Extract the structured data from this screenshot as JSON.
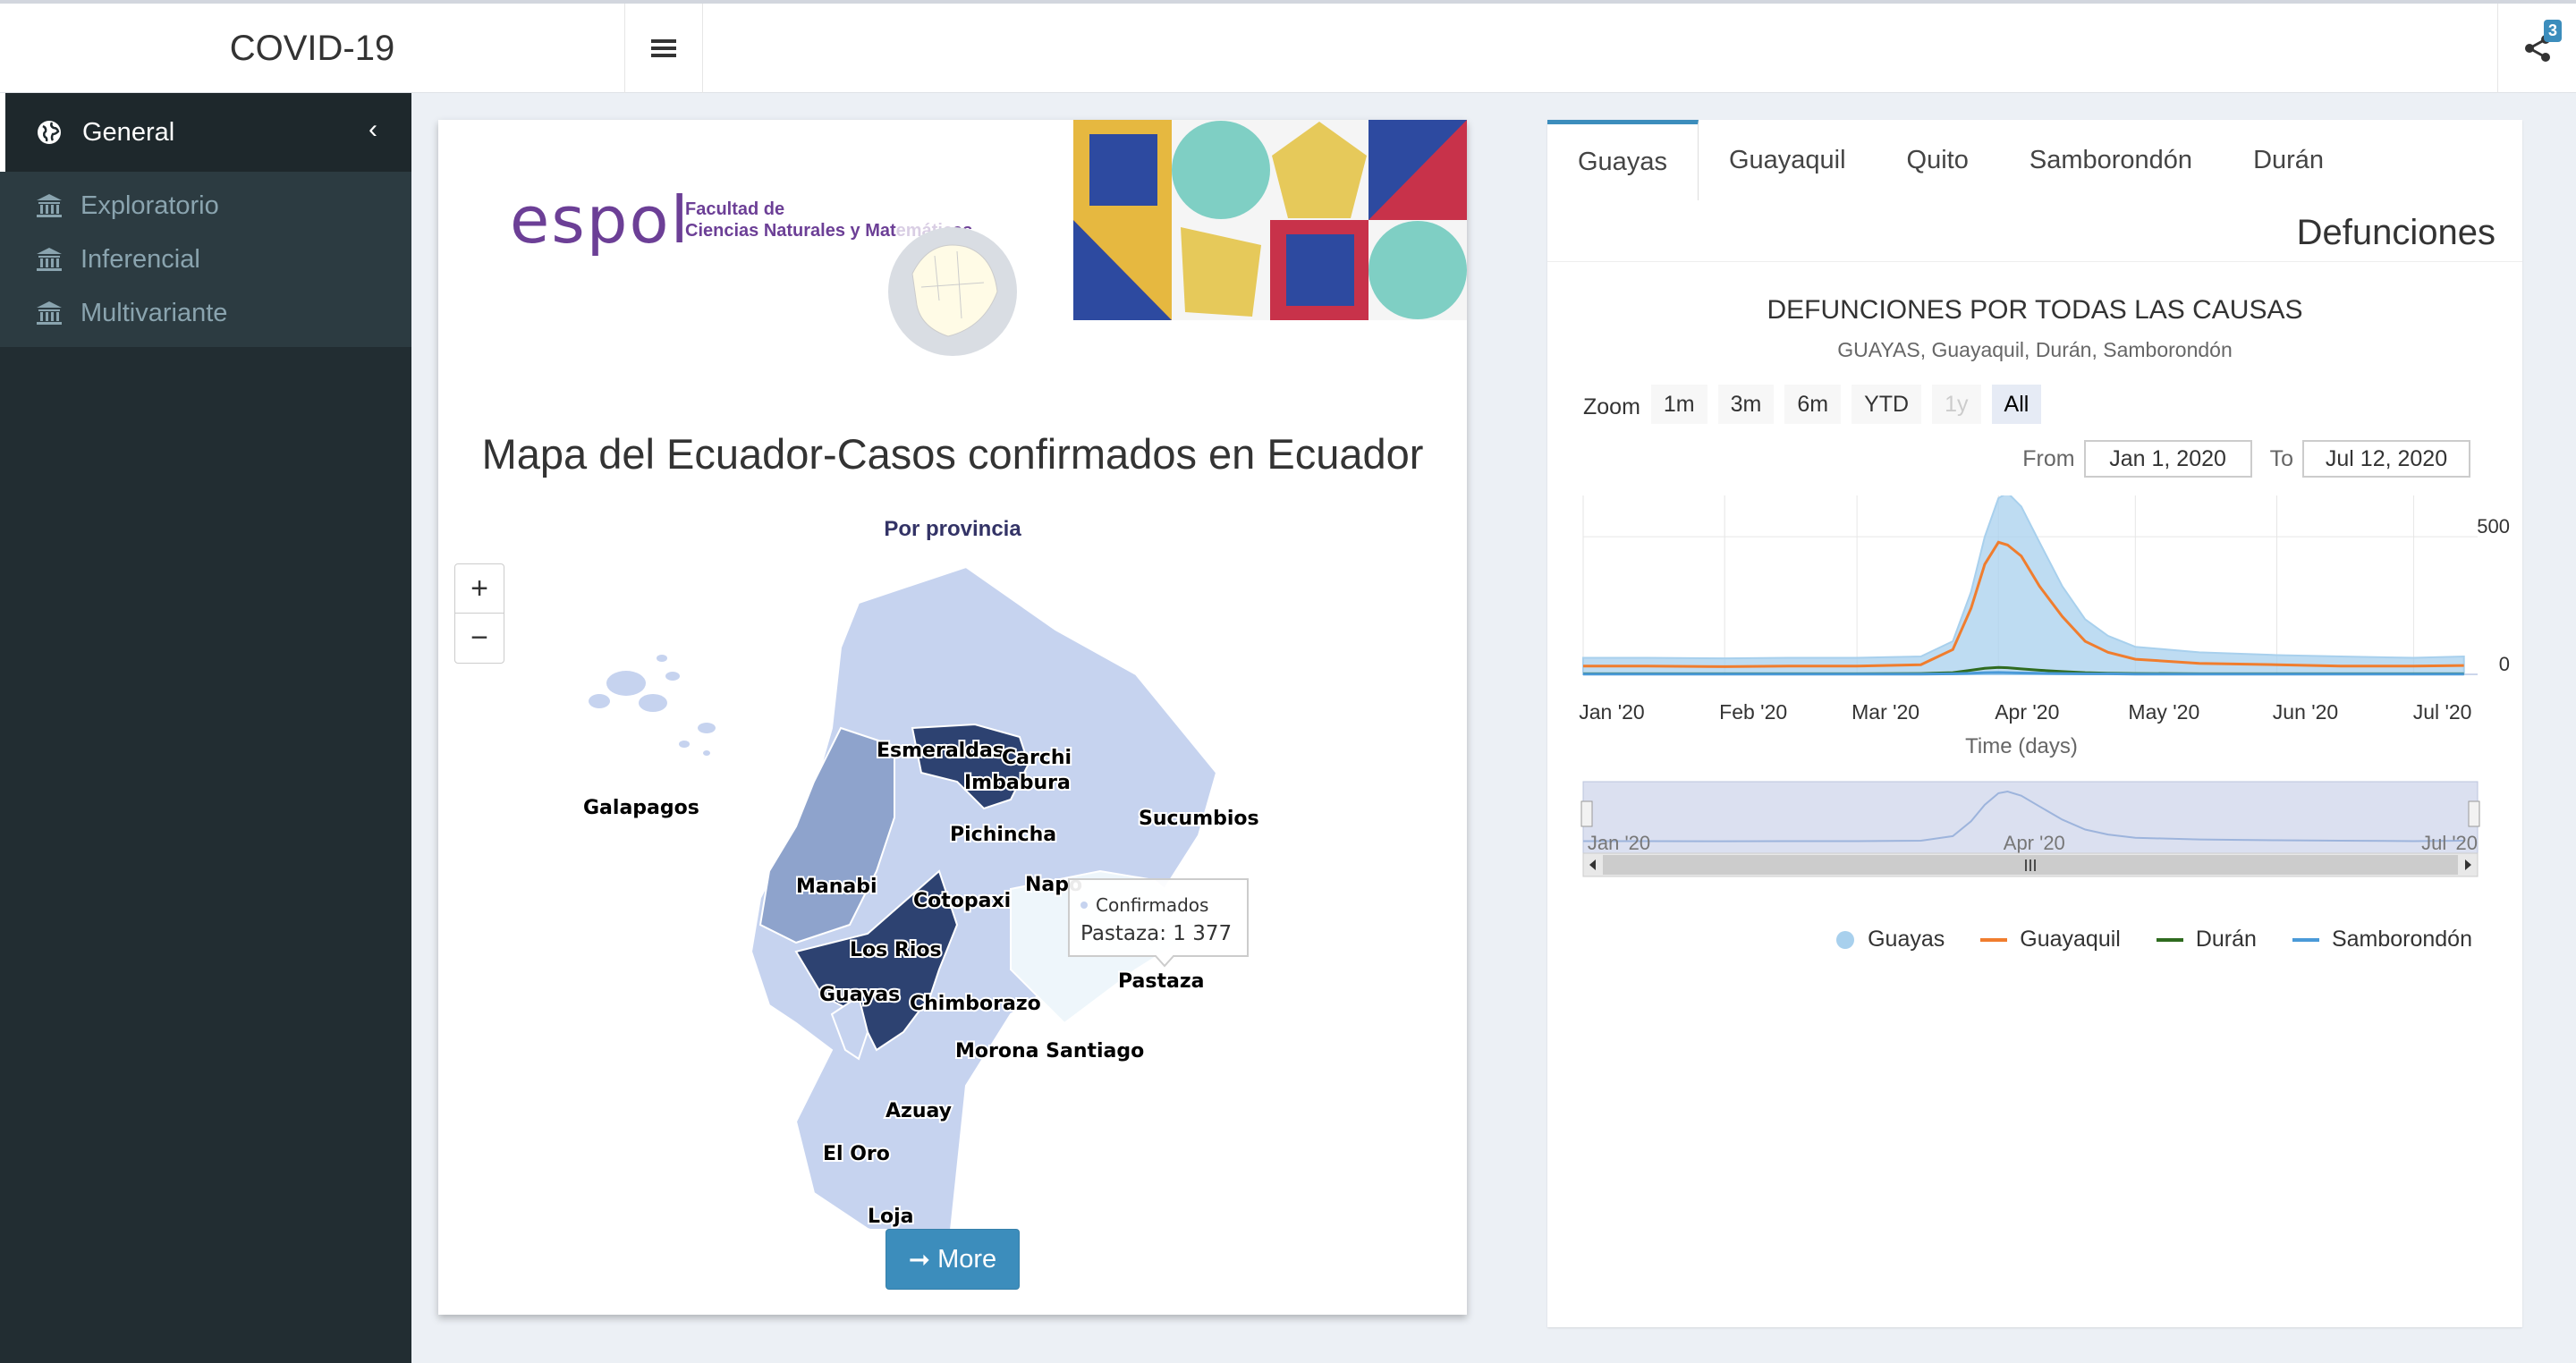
{
  "header": {
    "title": "COVID-19",
    "share_badge": "3"
  },
  "sidebar": {
    "section": "General",
    "items": [
      {
        "label": "Exploratorio"
      },
      {
        "label": "Inferencial"
      },
      {
        "label": "Multivariante"
      }
    ]
  },
  "left": {
    "logo_text": "espol",
    "faculty_line1": "Facultad de",
    "faculty_line2": "Ciencias Naturales y Mat",
    "faculty_line2_end": "as",
    "map_title": "Mapa del Ecuador-Casos confirmados en Ecuador",
    "map_subtitle": "Por provincia",
    "zoom_in": "+",
    "zoom_out": "−",
    "provinces": [
      "Galapagos",
      "Esmeraldas",
      "Carchi",
      "Imbabura",
      "Sucumbios",
      "Pichincha",
      "Manabi",
      "Napo",
      "Cotopaxi",
      "Los Rios",
      "Pastaza",
      "Guayas",
      "Chimborazo",
      "Morona Santiago",
      "Azuay",
      "El Oro",
      "Loja"
    ],
    "tooltip_series": "Confirmados",
    "tooltip_value": "Pastaza: 1 377",
    "more_button": "More",
    "more_icon": "arrow-right-icon"
  },
  "right": {
    "tabs": [
      "Guayas",
      "Guayaquil",
      "Quito",
      "Samborondón",
      "Durán"
    ],
    "active_tab": "Guayas",
    "section_title": "Defunciones",
    "zoom_label": "Zoom",
    "zoom_buttons": [
      "1m",
      "3m",
      "6m",
      "YTD",
      "1y",
      "All"
    ],
    "from_label": "From",
    "from_value": "Jan 1, 2020",
    "to_label": "To",
    "to_value": "Jul 12, 2020",
    "nav_labels": [
      "Jan '20",
      "Apr '20",
      "Jul '20"
    ],
    "nav_mid": "III"
  },
  "chart_data": {
    "type": "area",
    "title": "DEFUNCIONES POR TODAS LAS CAUSAS",
    "subtitle": "GUAYAS, Guayaquil, Durán, Samborondón",
    "xlabel": "Time (days)",
    "ylabel": "",
    "x_ticks": [
      "Jan '20",
      "Feb '20",
      "Mar '20",
      "Apr '20",
      "May '20",
      "Jun '20",
      "Jul '20"
    ],
    "y_ticks": [
      0,
      500
    ],
    "ylim": [
      0,
      650
    ],
    "x": [
      "2020-01-01",
      "2020-01-15",
      "2020-02-01",
      "2020-02-15",
      "2020-03-01",
      "2020-03-15",
      "2020-03-22",
      "2020-03-26",
      "2020-03-29",
      "2020-04-01",
      "2020-04-03",
      "2020-04-06",
      "2020-04-10",
      "2020-04-15",
      "2020-04-20",
      "2020-04-25",
      "2020-05-01",
      "2020-05-15",
      "2020-06-01",
      "2020-06-15",
      "2020-07-01",
      "2020-07-12"
    ],
    "series": [
      {
        "name": "Guayas",
        "values": [
          60,
          60,
          58,
          60,
          60,
          65,
          120,
          300,
          500,
          640,
          660,
          610,
          480,
          320,
          200,
          140,
          100,
          80,
          70,
          65,
          60,
          65
        ],
        "color": "#a8d0ed"
      },
      {
        "name": "Guayaquil",
        "values": [
          30,
          30,
          28,
          30,
          30,
          35,
          90,
          240,
          400,
          480,
          470,
          430,
          320,
          210,
          120,
          80,
          55,
          40,
          35,
          30,
          30,
          32
        ],
        "color": "#f07d2e"
      },
      {
        "name": "Durán",
        "values": [
          2,
          2,
          2,
          2,
          2,
          3,
          6,
          15,
          22,
          25,
          24,
          20,
          15,
          10,
          6,
          4,
          3,
          2,
          2,
          2,
          2,
          2
        ],
        "color": "#2f6b1f"
      },
      {
        "name": "Samborondón",
        "values": [
          1,
          1,
          1,
          1,
          1,
          1,
          2,
          4,
          6,
          7,
          6,
          5,
          4,
          3,
          2,
          2,
          1,
          1,
          1,
          1,
          1,
          1
        ],
        "color": "#4a9ad8"
      }
    ],
    "legend": "bottom-right"
  },
  "colors": {
    "accent": "#3c8dbc",
    "sidebar": "#222d32",
    "province_dark": "#2d4271",
    "province_mid": "#8ea3cc",
    "province_light": "#c6d3ef"
  }
}
